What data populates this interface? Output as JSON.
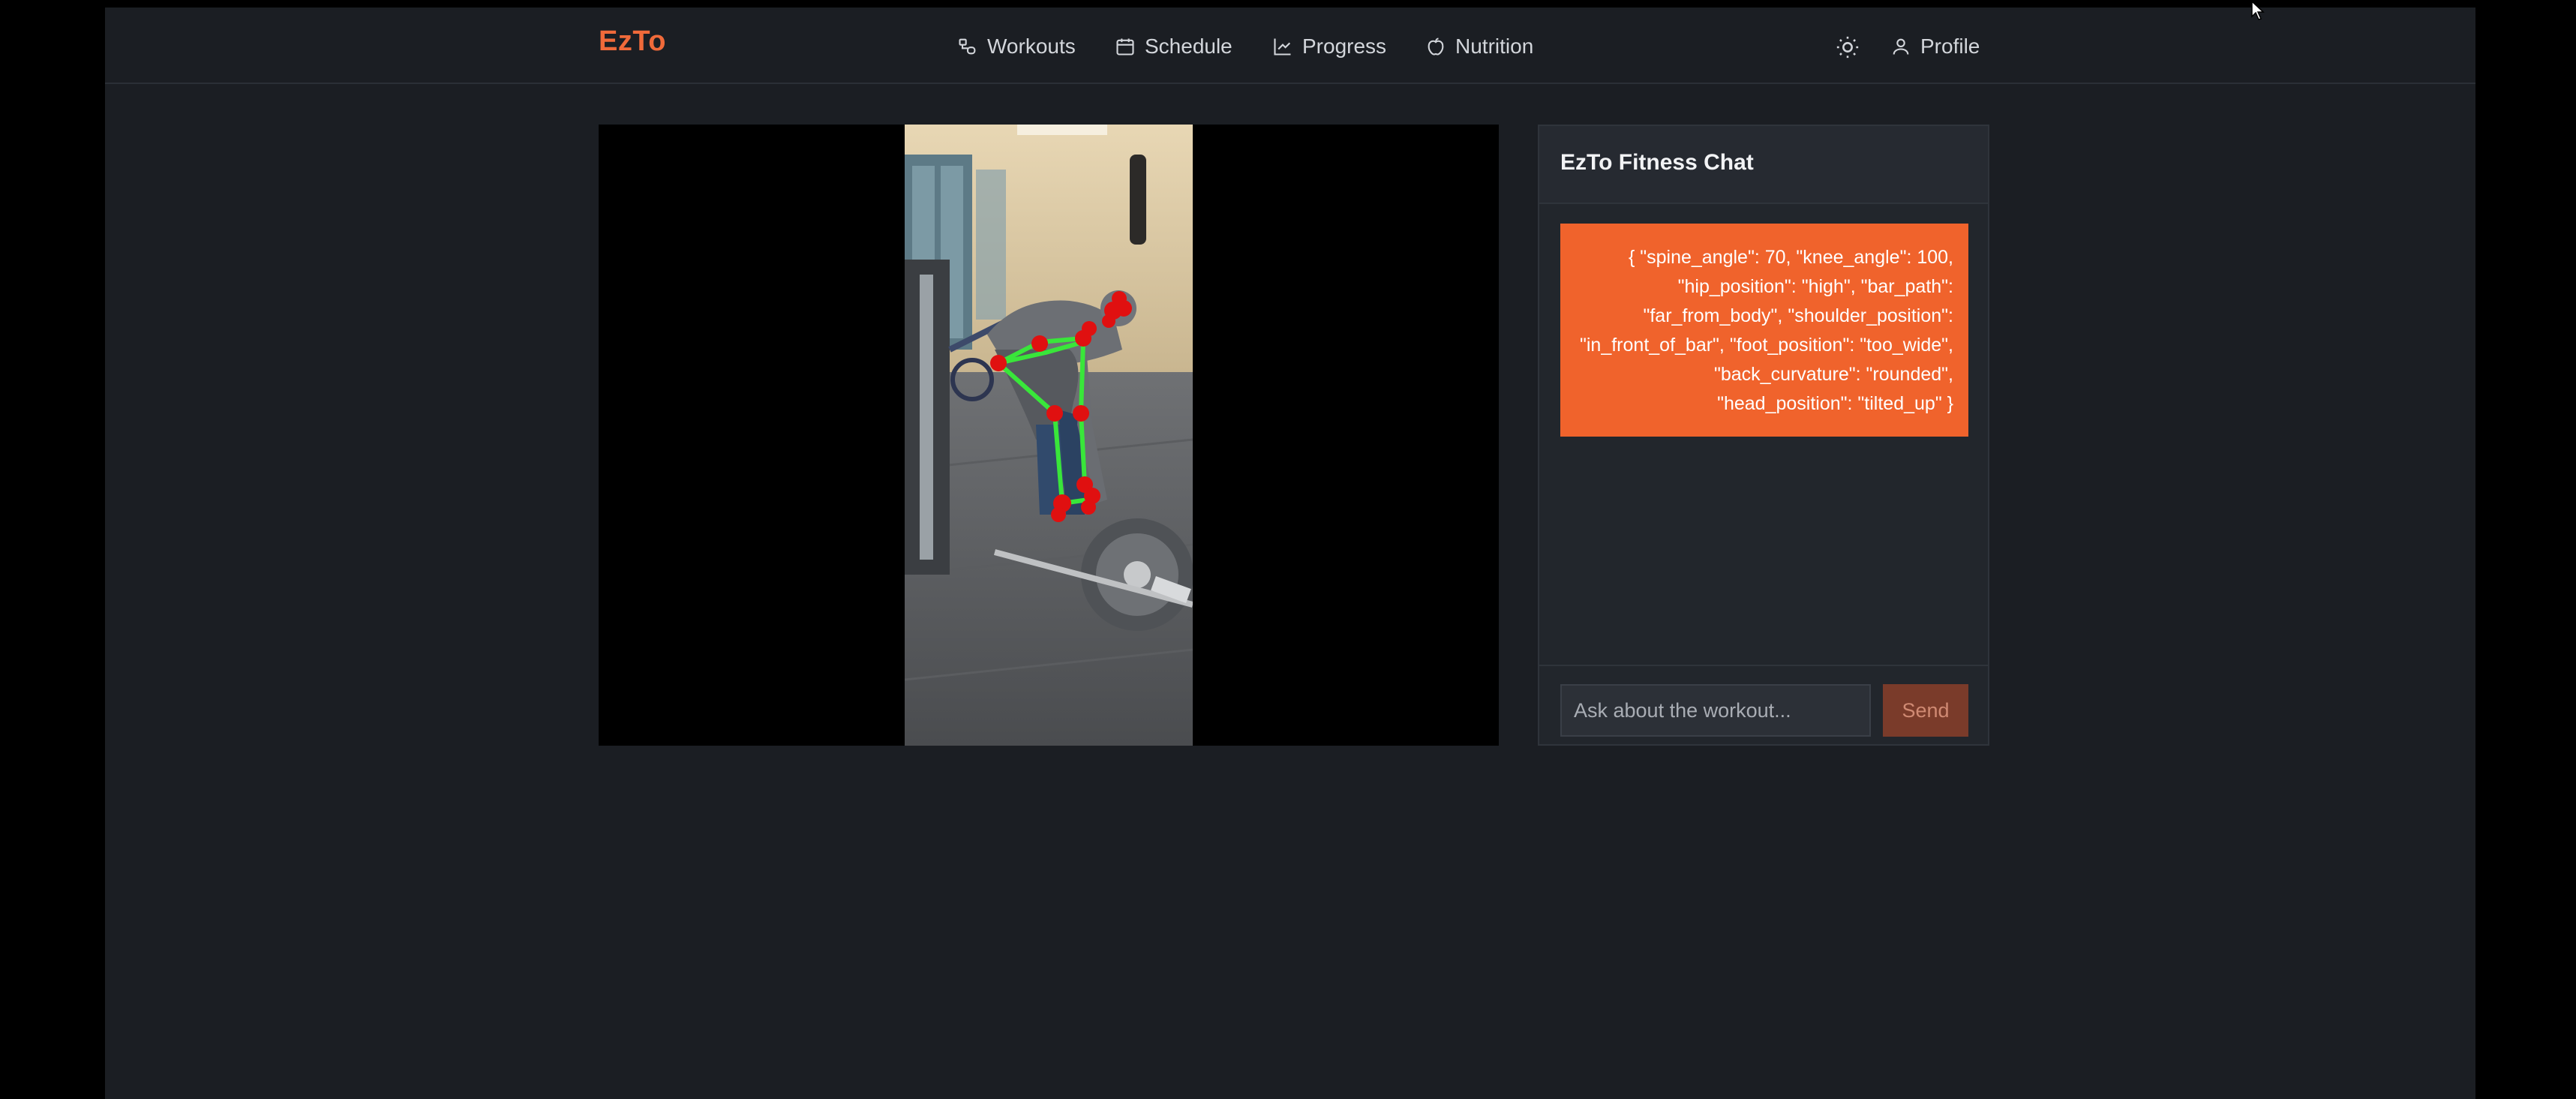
{
  "brand": "EzTo",
  "nav": {
    "workouts": "Workouts",
    "schedule": "Schedule",
    "progress": "Progress",
    "nutrition": "Nutrition",
    "profile": "Profile"
  },
  "icons": {
    "workouts": "workouts-icon",
    "schedule": "calendar-icon",
    "progress": "chart-line-icon",
    "nutrition": "apple-icon",
    "theme": "sun-icon",
    "profile": "user-icon"
  },
  "chat": {
    "title": "EzTo Fitness Chat",
    "message": "{ \"spine_angle\": 70, \"knee_angle\": 100, \"hip_position\": \"high\", \"bar_path\": \"far_from_body\", \"shoulder_position\": \"in_front_of_bar\", \"foot_position\": \"too_wide\", \"back_curvature\": \"rounded\", \"head_position\": \"tilted_up\" }",
    "input_placeholder": "Ask about the workout...",
    "input_value": "",
    "send_label": "Send"
  },
  "colors": {
    "accent": "#f06a3a",
    "bubble": "#f0632c",
    "background": "#1b1e23",
    "send_disabled": "#7a3b2a",
    "skeleton_line": "#39e63a",
    "skeleton_joint": "#e01010"
  }
}
